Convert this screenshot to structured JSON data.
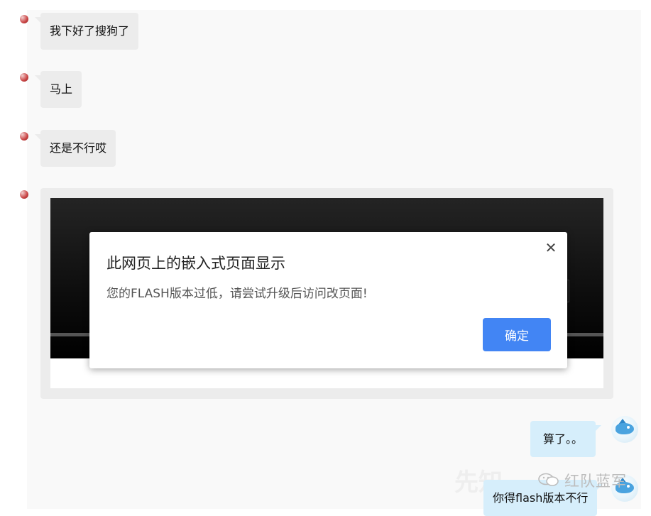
{
  "messages": [
    {
      "side": "left",
      "text": "我下好了搜狗了"
    },
    {
      "side": "left",
      "text": "马上"
    },
    {
      "side": "left",
      "text": "还是不行哎"
    },
    {
      "side": "right",
      "text": "算了。。"
    },
    {
      "side": "right",
      "text": "你得flash版本不行"
    }
  ],
  "dialog": {
    "title": "此网页上的嵌入式页面显示",
    "message": "您的FLASH版本过低，请尝试升级后访问改页面!",
    "ok_label": "确定",
    "close_glyph": "✕"
  },
  "watermark": {
    "text": "红队蓝军",
    "ghost_text": "先知"
  },
  "colors": {
    "left_bubble": "#ececec",
    "right_bubble": "#d6eefb",
    "ok_button": "#4285f4"
  }
}
